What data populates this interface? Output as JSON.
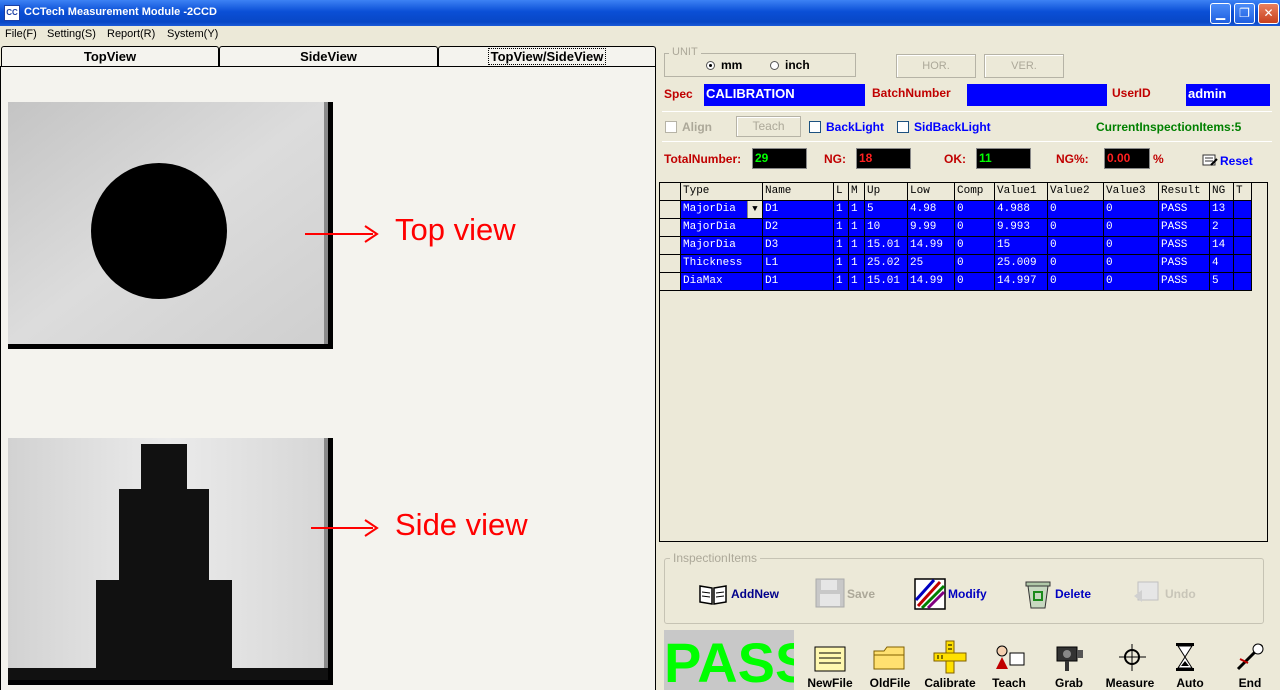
{
  "window": {
    "title": "CCTech Measurement Module -2CCD",
    "icon_text": "CC",
    "controls": {
      "minimize": "▁",
      "maximize": "❐",
      "close": "✕"
    }
  },
  "menu": [
    "File(F)",
    "Setting(S)",
    "Report(R)",
    "System(Y)"
  ],
  "tabs": [
    "TopView",
    "SideView",
    "TopView/SideView"
  ],
  "active_tab": "TopView/SideView",
  "annotations": {
    "top": "Top view",
    "side": "Side view"
  },
  "unit": {
    "legend": "UNIT",
    "options": [
      "mm",
      "inch"
    ],
    "selected": "mm"
  },
  "buttons": {
    "hor": "HOR.",
    "ver": "VER.",
    "teach": "Teach"
  },
  "spec": {
    "label": "Spec",
    "value": "CALIBRATION"
  },
  "batch": {
    "label": "BatchNumber",
    "value": ""
  },
  "user": {
    "label": "UserID",
    "value": "admin"
  },
  "options": {
    "align": "Align",
    "backlight": "BackLight",
    "sidbacklight": "SidBackLight",
    "current_items": "CurrentInspectionItems:5"
  },
  "counters": {
    "total_label": "TotalNumber:",
    "total": "29",
    "ng_label": "NG:",
    "ng": "18",
    "ok_label": "OK:",
    "ok": "11",
    "ngp_label": "NG%:",
    "ngp": "0.00",
    "pct": "%",
    "reset": "Reset"
  },
  "grid": {
    "columns": [
      "Type",
      "Name",
      "L",
      "M",
      "Up",
      "Low",
      "Comp",
      "Value1",
      "Value2",
      "Value3",
      "Result",
      "NG",
      "T"
    ],
    "rows": [
      [
        "MajorDia",
        "D1",
        "1",
        "1",
        "5",
        "4.98",
        "0",
        "4.988",
        "0",
        "0",
        "PASS",
        "13",
        ""
      ],
      [
        "MajorDia",
        "D2",
        "1",
        "1",
        "10",
        "9.99",
        "0",
        "9.993",
        "0",
        "0",
        "PASS",
        "2",
        ""
      ],
      [
        "MajorDia",
        "D3",
        "1",
        "1",
        "15.01",
        "14.99",
        "0",
        "15",
        "0",
        "0",
        "PASS",
        "14",
        ""
      ],
      [
        "Thickness",
        "L1",
        "1",
        "1",
        "25.02",
        "25",
        "0",
        "25.009",
        "0",
        "0",
        "PASS",
        "4",
        ""
      ],
      [
        "DiaMax",
        "D1",
        "1",
        "1",
        "15.01",
        "14.99",
        "0",
        "14.997",
        "0",
        "0",
        "PASS",
        "5",
        ""
      ]
    ]
  },
  "inspection_items": {
    "legend": "InspectionItems",
    "add": "AddNew",
    "save": "Save",
    "modify": "Modify",
    "delete": "Delete",
    "undo": "Undo"
  },
  "status": "PASS",
  "toolbar": [
    "NewFile",
    "OldFile",
    "Calibrate",
    "Teach",
    "Grab",
    "Measure",
    "Auto",
    "End"
  ],
  "colors": {
    "grid_row": "#0000ff",
    "pass": "#00ff00",
    "label_red": "#c00000",
    "label_blue": "#0000ff"
  }
}
